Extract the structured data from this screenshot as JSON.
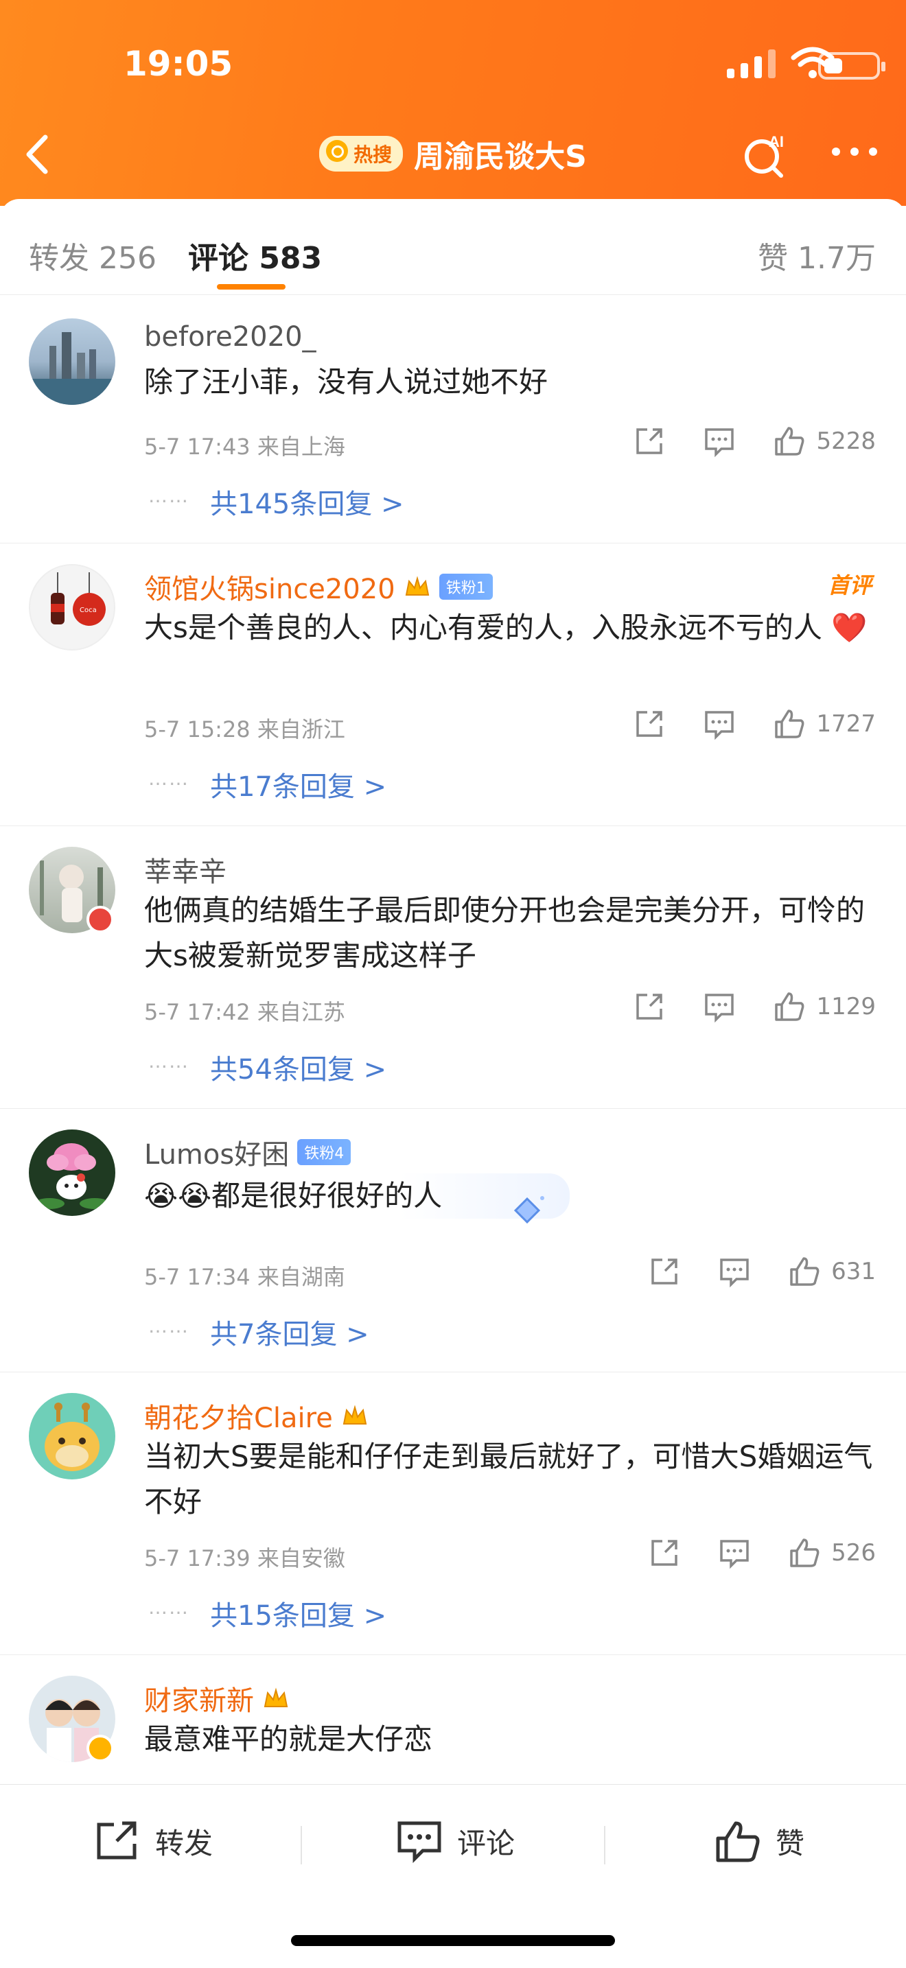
{
  "status_bar": {
    "time": "19:05"
  },
  "header": {
    "hot_badge": "热搜",
    "title": "周渝民谈大S",
    "ai_label": "AI"
  },
  "tabs": {
    "repost": "转发 256",
    "comments": "评论 583",
    "likes": "赞 1.7万"
  },
  "comments": [
    {
      "name": "before2020_",
      "text": "除了汪小菲，没有人说过她不好",
      "meta": "5-7 17:43  来自上海",
      "likes": "5228",
      "replies": "共145条回复 >",
      "first_tag": "",
      "fan_badge": ""
    },
    {
      "name": "领馆火锅since2020",
      "fan_badge": "铁粉1",
      "text": "大s是个善良的人、内心有爱的人，入股永远不亏的人 ❤️",
      "meta": "5-7 15:28  来自浙江",
      "likes": "1727",
      "replies": "共17条回复 >",
      "first_tag": "首评"
    },
    {
      "name": "莘幸辛",
      "text": "他俩真的结婚生子最后即使分开也会是完美分开，可怜的大s被爱新觉罗害成这样子",
      "meta": "5-7 17:42  来自江苏",
      "likes": "1129",
      "replies": "共54条回复 >",
      "first_tag": "",
      "fan_badge": ""
    },
    {
      "name": "Lumos好困",
      "fan_badge": "铁粉4",
      "text": "😭😭都是很好很好的人",
      "meta": "5-7 17:34  来自湖南",
      "likes": "631",
      "replies": "共7条回复 >",
      "first_tag": ""
    },
    {
      "name": "朝花夕拾Claire",
      "text": "当初大S要是能和仔仔走到最后就好了，可惜大S婚姻运气不好",
      "meta": "5-7 17:39  来自安徽",
      "likes": "526",
      "replies": "共15条回复 >",
      "first_tag": "",
      "fan_badge": ""
    },
    {
      "name": "财家新新",
      "text": "最意难平的就是大仔恋",
      "meta": "",
      "likes": "",
      "replies": "",
      "first_tag": "",
      "fan_badge": ""
    }
  ],
  "dots": "……",
  "bottom_bar": {
    "repost": "转发",
    "comment": "评论",
    "like": "赞"
  },
  "colors": {
    "header": "#ff7a1a",
    "accent": "#ff8200",
    "link": "#4a7ccf",
    "name_vip": "#f06a12"
  }
}
